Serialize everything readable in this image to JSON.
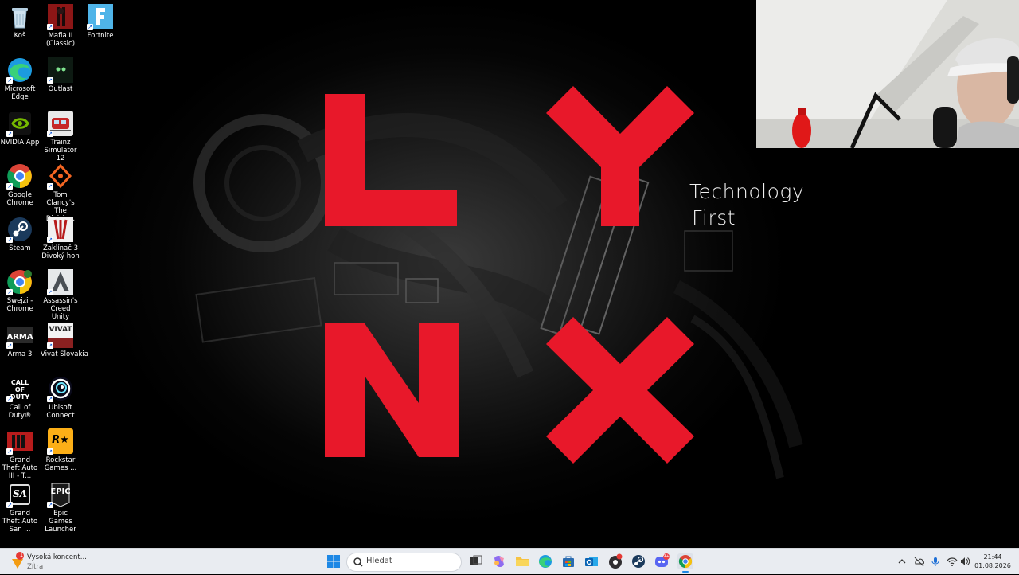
{
  "wallpaper": {
    "brand_letters": [
      "L",
      "Y",
      "N",
      "X"
    ],
    "brand_color": "#e8182a",
    "tagline_line1": "Technology",
    "tagline_line2": "First"
  },
  "desktop_icons": [
    {
      "label": "Koš",
      "icon": "recycle-bin-icon",
      "shortcut": false
    },
    {
      "label": "Mafia II (Classic)",
      "icon": "mafia-icon",
      "shortcut": true
    },
    {
      "label": "Fortnite",
      "icon": "fortnite-icon",
      "shortcut": true
    },
    {
      "label": "Microsoft Edge",
      "icon": "edge-icon",
      "shortcut": true
    },
    {
      "label": "Outlast",
      "icon": "outlast-icon",
      "shortcut": true
    },
    {
      "label": "NVIDIA App",
      "icon": "nvidia-icon",
      "shortcut": true
    },
    {
      "label": "Trainz Simulator 12",
      "icon": "trainz-icon",
      "shortcut": true
    },
    {
      "label": "Google Chrome",
      "icon": "chrome-icon",
      "shortcut": true
    },
    {
      "label": "Tom Clancy's The Divisio...",
      "icon": "division-icon",
      "shortcut": true
    },
    {
      "label": "Steam",
      "icon": "steam-icon",
      "shortcut": true
    },
    {
      "label": "Zaklínač 3 Divoký hon",
      "icon": "witcher-icon",
      "shortcut": true
    },
    {
      "label": "Swejzi - Chrome",
      "icon": "chrome-profile-icon",
      "shortcut": true
    },
    {
      "label": "Assassin's Creed Unity",
      "icon": "assassins-creed-icon",
      "shortcut": true
    },
    {
      "label": "Arma 3",
      "icon": "arma-icon",
      "shortcut": true
    },
    {
      "label": "Vivat Slovakia",
      "icon": "vivat-slovakia-icon",
      "shortcut": true
    },
    {
      "label": "Call of Duty®",
      "icon": "call-of-duty-icon",
      "shortcut": true
    },
    {
      "label": "Ubisoft Connect",
      "icon": "ubisoft-icon",
      "shortcut": true
    },
    {
      "label": "Grand Theft Auto III - T...",
      "icon": "gta3-icon",
      "shortcut": true
    },
    {
      "label": "Rockstar Games ...",
      "icon": "rockstar-icon",
      "shortcut": true
    },
    {
      "label": "Grand Theft Auto San ...",
      "icon": "gta-sa-icon",
      "shortcut": true
    },
    {
      "label": "Epic Games Launcher",
      "icon": "epic-games-icon",
      "shortcut": true
    }
  ],
  "icon_glyphs": {
    "call_of_duty": "CALL OF DUTY",
    "rockstar": "R★",
    "vivat": "VIVAT",
    "epic": "EPIC",
    "gta_sa": "SA"
  },
  "notification": {
    "badge": "1",
    "title": "Vysoká koncent...",
    "subtitle": "Zítra"
  },
  "taskbar": {
    "search_placeholder": "Hledat",
    "pinned": [
      "start-icon",
      "task-view-icon",
      "copilot-icon",
      "file-explorer-icon",
      "edge-icon",
      "store-icon",
      "outlook-icon",
      "obs-icon",
      "steam-icon",
      "discord-icon",
      "chrome-icon"
    ],
    "discord_badge": "9+"
  },
  "clock": {
    "time": "21:44",
    "date": "01.08.2026"
  }
}
